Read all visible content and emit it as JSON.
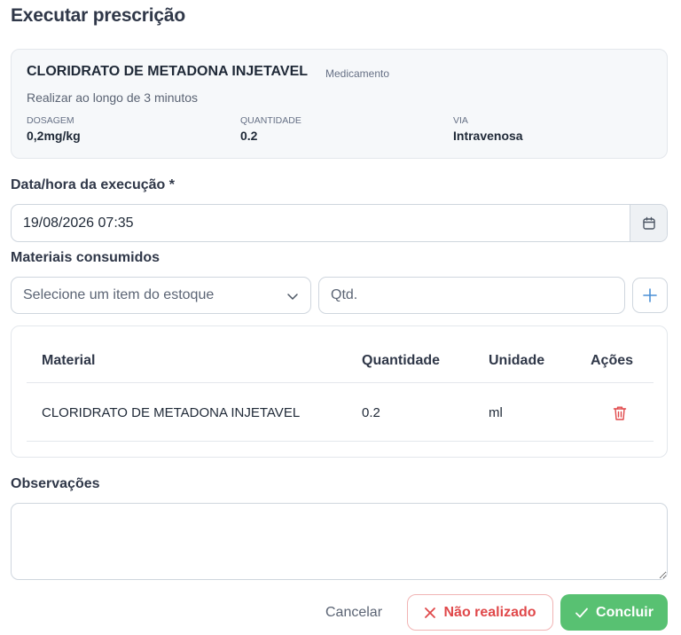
{
  "dialog": {
    "title": "Executar prescrição"
  },
  "medication": {
    "name": "CLORIDRATO DE METADONA INJETAVEL",
    "type": "Medicamento",
    "instructions": "Realizar ao longo de 3 minutos",
    "fields": [
      {
        "label": "DOSAGEM",
        "value": "0,2mg/kg"
      },
      {
        "label": "QUANTIDADE",
        "value": "0.2"
      },
      {
        "label": "VIA",
        "value": "Intravenosa"
      }
    ]
  },
  "execution": {
    "label": "Data/hora da execução *",
    "value": "19/08/2026 07:35",
    "calendar_icon": "calendar-icon"
  },
  "materials": {
    "label": "Materiais consumidos",
    "select_placeholder": "Selecione um item do estoque",
    "qty_placeholder": "Qtd.",
    "add_icon": "plus-icon",
    "table": {
      "headers": {
        "material": "Material",
        "quantity": "Quantidade",
        "unit": "Unidade",
        "actions": "Ações"
      },
      "rows": [
        {
          "material": "CLORIDRATO DE METADONA INJETAVEL",
          "quantity": "0.2",
          "unit": "ml",
          "action_icon": "trash-icon"
        }
      ]
    }
  },
  "observations": {
    "label": "Observações",
    "value": ""
  },
  "actions": {
    "cancel": "Cancelar",
    "not_done": "Não realizado",
    "done": "Concluir"
  },
  "colors": {
    "danger": "#e0484a",
    "success": "#58c172",
    "accent": "#4a8fd6",
    "text": "#2b3446"
  }
}
